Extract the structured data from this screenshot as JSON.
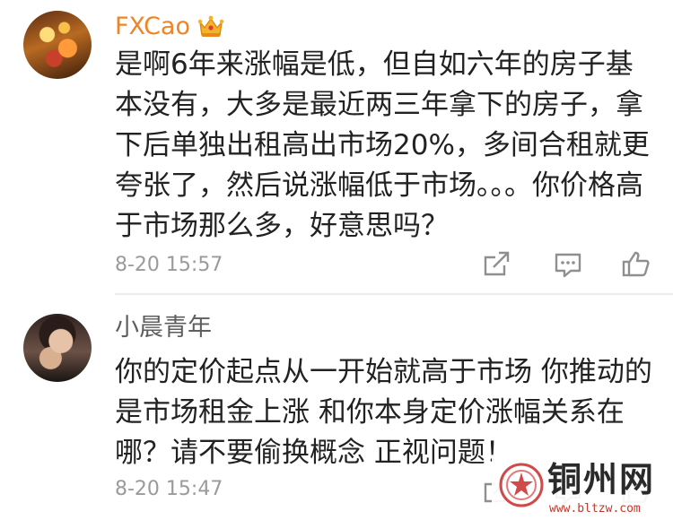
{
  "comments": [
    {
      "username": "FXCao",
      "badge_icon": "vip-crown-icon",
      "text": "是啊6年来涨幅是低，但自如六年的房子基本没有，大多是最近两三年拿下的房子，拿下后单独出租高出市场20%，多间合租就更夸张了，然后说涨幅低于市场。。。你价格高于市场那么多，好意思吗？",
      "time": "8-20 15:57",
      "actions": [
        "share-icon",
        "reply-icon",
        "like-icon"
      ]
    },
    {
      "username": "小晨青年",
      "text": "你的定价起点从一开始就高于市场 你推动的是市场租金上涨 和你本身定价涨幅关系在哪？请不要偷换概念 正视问题！",
      "time": "8-20 15:47",
      "actions": [
        "share-icon",
        "reply-icon",
        "like-icon"
      ]
    }
  ],
  "watermark": {
    "title": "铜州网",
    "url": "www.bltzw.com"
  },
  "colors": {
    "vip_name": "#f08425",
    "name": "#5e5e5e",
    "text": "#222222",
    "meta": "#9a9a9a",
    "watermark_red": "#c0392b"
  }
}
